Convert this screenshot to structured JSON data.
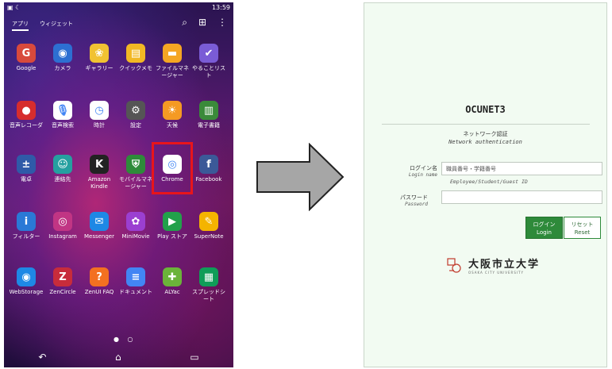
{
  "phone": {
    "status_time": "13:59",
    "tabs": [
      "アプリ",
      "ウィジェット"
    ],
    "apps": [
      {
        "label": "Google",
        "icon": "google-icon",
        "color": "#d84a3c"
      },
      {
        "label": "カメラ",
        "icon": "camera-icon",
        "color": "#2d6fd2"
      },
      {
        "label": "ギャラリー",
        "icon": "gallery-icon",
        "color": "#f1c232"
      },
      {
        "label": "クイックメモ",
        "icon": "memo-icon",
        "color": "#f2b824"
      },
      {
        "label": "ファイルマネージャー",
        "icon": "folder-icon",
        "color": "#f5a623"
      },
      {
        "label": "やることリスト",
        "icon": "checklist-icon",
        "color": "#7a5cd6"
      },
      {
        "label": "音声レコーダ",
        "icon": "recorder-icon",
        "color": "#d62d2d"
      },
      {
        "label": "音声検索",
        "icon": "mic-icon",
        "color": "#ffffff"
      },
      {
        "label": "時計",
        "icon": "clock-icon",
        "color": "#ffffff"
      },
      {
        "label": "設定",
        "icon": "settings-icon",
        "color": "#555555"
      },
      {
        "label": "天候",
        "icon": "weather-icon",
        "color": "#f59a23"
      },
      {
        "label": "電子書籍",
        "icon": "ebook-icon",
        "color": "#3a8a3a"
      },
      {
        "label": "電卓",
        "icon": "calculator-icon",
        "color": "#2f5aa8"
      },
      {
        "label": "連絡先",
        "icon": "contacts-icon",
        "color": "#25a0a0"
      },
      {
        "label": "Amazon Kindle",
        "icon": "kindle-icon",
        "color": "#222222"
      },
      {
        "label": "モバイルマネージャー",
        "icon": "shield-icon",
        "color": "#2e8b3a"
      },
      {
        "label": "Chrome",
        "icon": "chrome-icon",
        "color": "#ffffff"
      },
      {
        "label": "Facebook",
        "icon": "facebook-icon",
        "color": "#3b5998"
      },
      {
        "label": "フィルター",
        "icon": "filter-icon",
        "color": "#2a79d6"
      },
      {
        "label": "Instagram",
        "icon": "instagram-icon",
        "color": "#c13584"
      },
      {
        "label": "Messenger",
        "icon": "messenger-icon",
        "color": "#1e88e5"
      },
      {
        "label": "MiniMovie",
        "icon": "minimovie-icon",
        "color": "#9b3fd1"
      },
      {
        "label": "Play ストア",
        "icon": "play-store-icon",
        "color": "#22a04b"
      },
      {
        "label": "SuperNote",
        "icon": "supernote-icon",
        "color": "#f4b400"
      },
      {
        "label": "WebStorage",
        "icon": "webstorage-icon",
        "color": "#1e88e5"
      },
      {
        "label": "ZenCircle",
        "icon": "zencircle-icon",
        "color": "#c72c3b"
      },
      {
        "label": "ZenUI FAQ",
        "icon": "faq-icon",
        "color": "#f37021"
      },
      {
        "label": "ドキュメント",
        "icon": "document-icon",
        "color": "#4285f4"
      },
      {
        "label": "ALYac",
        "icon": "alyac-icon",
        "color": "#6bb33a"
      },
      {
        "label": "スプレッドシート",
        "icon": "spreadsheet-icon",
        "color": "#0f9d58"
      }
    ],
    "highlight_color": "#e8151b"
  },
  "login": {
    "title": "OCUNET3",
    "subtitle_jp": "ネットワーク認証",
    "subtitle_en": "Network authentication",
    "login_label_jp": "ログイン名",
    "login_label_en": "Login name",
    "login_placeholder": "職員番号・学籍番号",
    "login_hint": "Employee/Student/Guest ID",
    "password_label_jp": "パスワード",
    "password_label_en": "Password",
    "login_button_jp": "ログイン",
    "login_button_en": "Login",
    "reset_button_jp": "リセット",
    "reset_button_en": "Reset",
    "university_name": "大阪市立大学",
    "university_name_en": "OSAKA CITY UNIVERSITY",
    "brand_color": "#2e8a3a"
  }
}
